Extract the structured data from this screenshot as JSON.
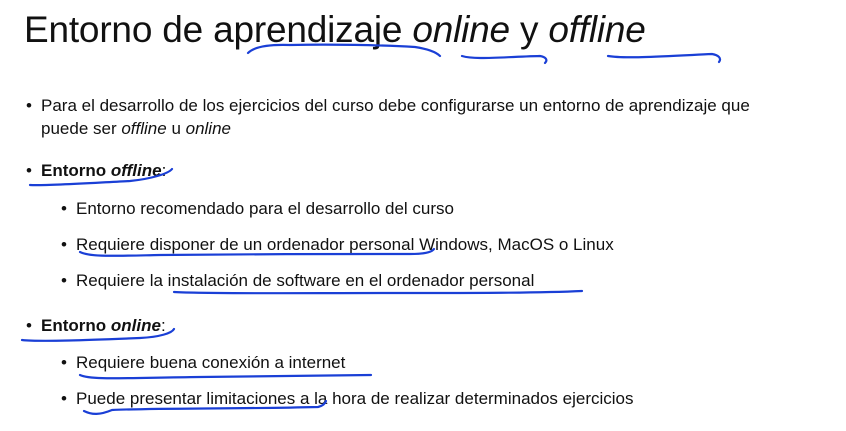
{
  "title": {
    "part1": "Entorno de ",
    "part2": "aprendizaje",
    "part3": " ",
    "part4": "online",
    "part5": " y ",
    "part6": "offline"
  },
  "intro": {
    "line1": "Para el desarrollo de los ejercicios del curso debe configurarse un entorno de aprendizaje que",
    "line2_a": "puede ser ",
    "line2_b": "offline",
    "line2_c": " u ",
    "line2_d": "online"
  },
  "offline_section": {
    "heading_a": "Entorno ",
    "heading_b": "offline",
    "heading_c": ":",
    "items": [
      "Entorno recomendado para el desarrollo del curso",
      "Requiere disponer de un ordenador personal Windows, MacOS o Linux",
      "Requiere la instalación de software en el ordenador personal"
    ]
  },
  "online_section": {
    "heading_a": "Entorno ",
    "heading_b": "online",
    "heading_c": ":",
    "items": [
      "Requiere buena conexión a internet",
      "Puede presentar limitaciones a la hora de realizar determinados ejercicios"
    ]
  },
  "bullet_glyph": "•",
  "colors": {
    "text": "#111111",
    "annotation_ink": "#1a3fd6",
    "background": "#ffffff"
  }
}
